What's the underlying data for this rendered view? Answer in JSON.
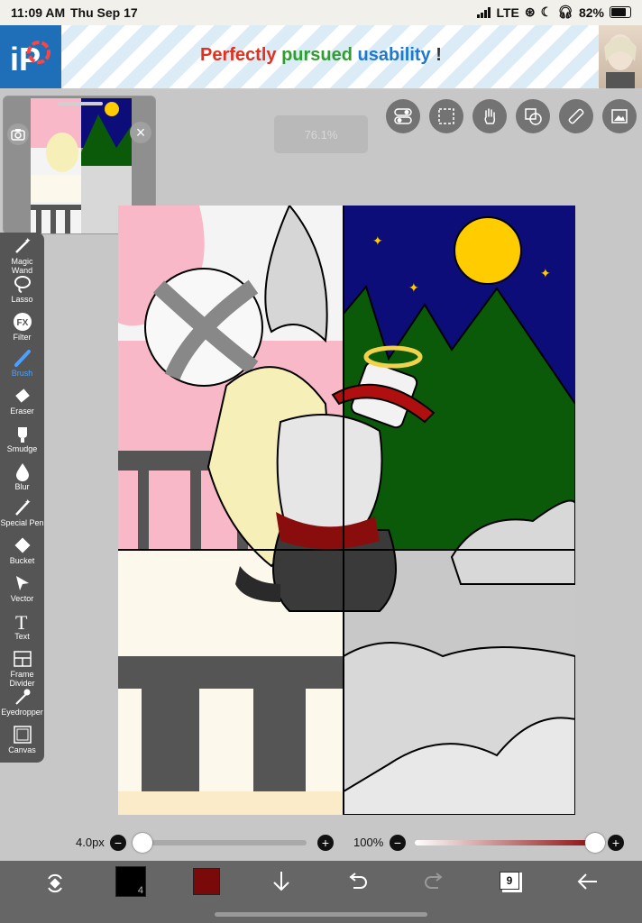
{
  "status": {
    "time": "11:09 AM",
    "date": "Thu Sep 17",
    "network": "LTE",
    "battery": "82%"
  },
  "banner": {
    "logo_text": "iP",
    "tagline_words": [
      "Perfectly",
      "pursued",
      "usability",
      "!"
    ],
    "tagline_colors": [
      "#e0301e",
      "#2f9e2f",
      "#1e78d0",
      "#333333"
    ]
  },
  "zoom_label": "76.1%",
  "top_tools": [
    "toggle-icon",
    "selection-icon",
    "hand-icon",
    "layer-transform-icon",
    "ruler-icon",
    "image-icon"
  ],
  "tools": [
    {
      "label": "Magic Wand"
    },
    {
      "label": "Lasso"
    },
    {
      "label": "Filter"
    },
    {
      "label": "Brush",
      "active": true
    },
    {
      "label": "Eraser"
    },
    {
      "label": "Smudge"
    },
    {
      "label": "Blur"
    },
    {
      "label": "Special Pen"
    },
    {
      "label": "Bucket"
    },
    {
      "label": "Vector"
    },
    {
      "label": "Text"
    },
    {
      "label": "Frame Divider"
    },
    {
      "label": "Eyedropper"
    },
    {
      "label": "Canvas"
    }
  ],
  "brush": {
    "size_label": "4.0px",
    "size_fraction": 0.04,
    "opacity_label": "100%",
    "opacity_fraction": 1.0
  },
  "bottom": {
    "primary_color": "#000000",
    "secondary_color": "#7a0a0a",
    "brush_number": "4",
    "layer_count": "9"
  },
  "colors": {
    "sky": "#0d0d7a",
    "moon": "#ffcc00",
    "mountain": "#0a5a0a",
    "pink": "#f8b8c8",
    "floor": "#fdf8ec"
  }
}
